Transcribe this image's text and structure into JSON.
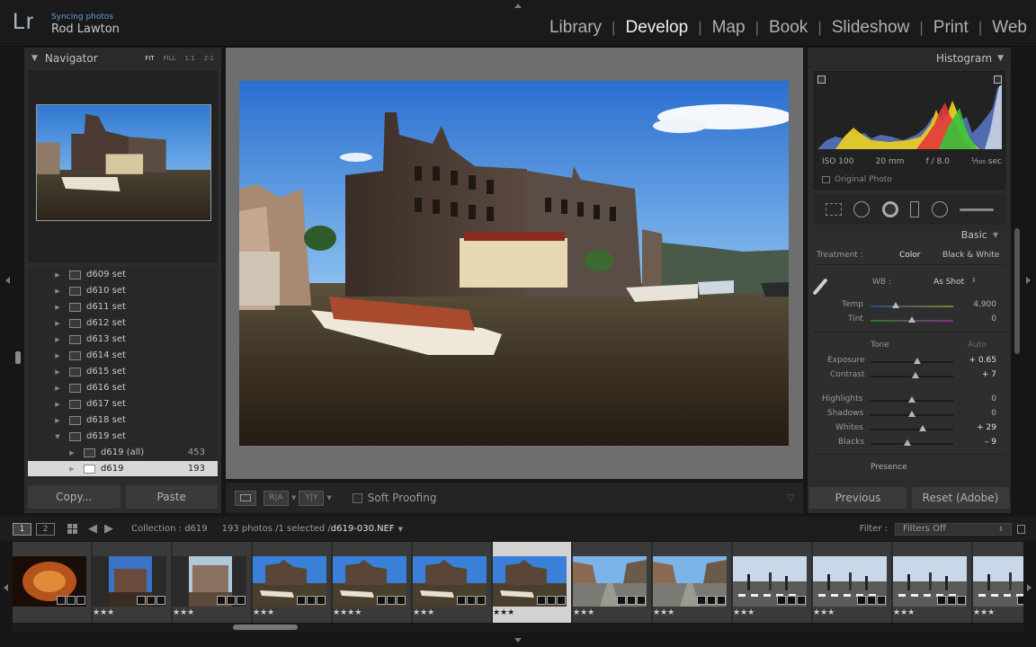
{
  "app": {
    "logo": "Lr",
    "sync_status": "Syncing photos",
    "user_name": "Rod Lawton"
  },
  "modules": [
    {
      "label": "Library",
      "active": false
    },
    {
      "label": "Develop",
      "active": true
    },
    {
      "label": "Map",
      "active": false
    },
    {
      "label": "Book",
      "active": false
    },
    {
      "label": "Slideshow",
      "active": false
    },
    {
      "label": "Print",
      "active": false
    },
    {
      "label": "Web",
      "active": false
    }
  ],
  "navigator": {
    "title": "Navigator",
    "options": [
      "FIT",
      "FILL",
      "1:1",
      "2:1"
    ],
    "selected_option": "FIT"
  },
  "collections": [
    {
      "name": "d609 set",
      "count": ""
    },
    {
      "name": "d610 set",
      "count": ""
    },
    {
      "name": "d611 set",
      "count": ""
    },
    {
      "name": "d612 set",
      "count": ""
    },
    {
      "name": "d613 set",
      "count": ""
    },
    {
      "name": "d614 set",
      "count": ""
    },
    {
      "name": "d615 set",
      "count": ""
    },
    {
      "name": "d616 set",
      "count": ""
    },
    {
      "name": "d617 set",
      "count": ""
    },
    {
      "name": "d618 set",
      "count": ""
    },
    {
      "name": "d619 set",
      "count": ""
    },
    {
      "name": "d619 (all)",
      "count": "453"
    },
    {
      "name": "d619",
      "count": "193"
    }
  ],
  "left_buttons": {
    "copy": "Copy...",
    "paste": "Paste"
  },
  "toolbar": {
    "soft_proofing": "Soft Proofing",
    "btn_ra": "R|A",
    "btn_yy": "Y|Y"
  },
  "histogram": {
    "title": "Histogram",
    "iso": "ISO 100",
    "focal": "20 mm",
    "aperture": "f / 8.0",
    "shutter": "¹⁄₅₀₀ sec",
    "original_photo": "Original Photo"
  },
  "basic": {
    "title": "Basic",
    "treatment_label": "Treatment :",
    "treatment_color": "Color",
    "treatment_bw": "Black & White",
    "wb_label": "WB :",
    "wb_value": "As Shot",
    "temp_label": "Temp",
    "temp_value": "4,900",
    "temp_pos": 0.3,
    "tint_label": "Tint",
    "tint_value": "0",
    "tint_pos": 0.5,
    "tone_label": "Tone",
    "auto_label": "Auto",
    "exposure_label": "Exposure",
    "exposure_value": "+ 0.65",
    "exposure_pos": 0.56,
    "contrast_label": "Contrast",
    "contrast_value": "+ 7",
    "contrast_pos": 0.54,
    "highlights_label": "Highlights",
    "highlights_value": "0",
    "highlights_pos": 0.5,
    "shadows_label": "Shadows",
    "shadows_value": "0",
    "shadows_pos": 0.5,
    "whites_label": "Whites",
    "whites_value": "+ 29",
    "whites_pos": 0.63,
    "blacks_label": "Blacks",
    "blacks_value": "– 9",
    "blacks_pos": 0.45,
    "presence_label": "Presence"
  },
  "right_buttons": {
    "previous": "Previous",
    "reset": "Reset (Adobe)"
  },
  "filmbar": {
    "screen1": "1",
    "screen2": "2",
    "collection": "Collection : d619",
    "photo_count": "193 photos /1 selected /",
    "filename": "d619-030.NEF",
    "filter_label": "Filter :",
    "filter_value": "Filters Off"
  },
  "filmstrip": [
    {
      "stars": "",
      "selected": false,
      "kind": "orange"
    },
    {
      "stars": "★★★",
      "selected": false,
      "kind": "portrait"
    },
    {
      "stars": "★★★",
      "selected": false,
      "kind": "portrait2"
    },
    {
      "stars": "★★★",
      "selected": false,
      "kind": "canal"
    },
    {
      "stars": "★★★★",
      "selected": false,
      "kind": "canal"
    },
    {
      "stars": "★★★",
      "selected": false,
      "kind": "canal"
    },
    {
      "stars": "★★★",
      "selected": true,
      "kind": "canal"
    },
    {
      "stars": "★★★",
      "selected": false,
      "kind": "street"
    },
    {
      "stars": "★★★",
      "selected": false,
      "kind": "street"
    },
    {
      "stars": "★★★",
      "selected": false,
      "kind": "crossing"
    },
    {
      "stars": "★★★",
      "selected": false,
      "kind": "crossing"
    },
    {
      "stars": "★★★",
      "selected": false,
      "kind": "crossing"
    },
    {
      "stars": "★★★",
      "selected": false,
      "kind": "crossing"
    }
  ]
}
